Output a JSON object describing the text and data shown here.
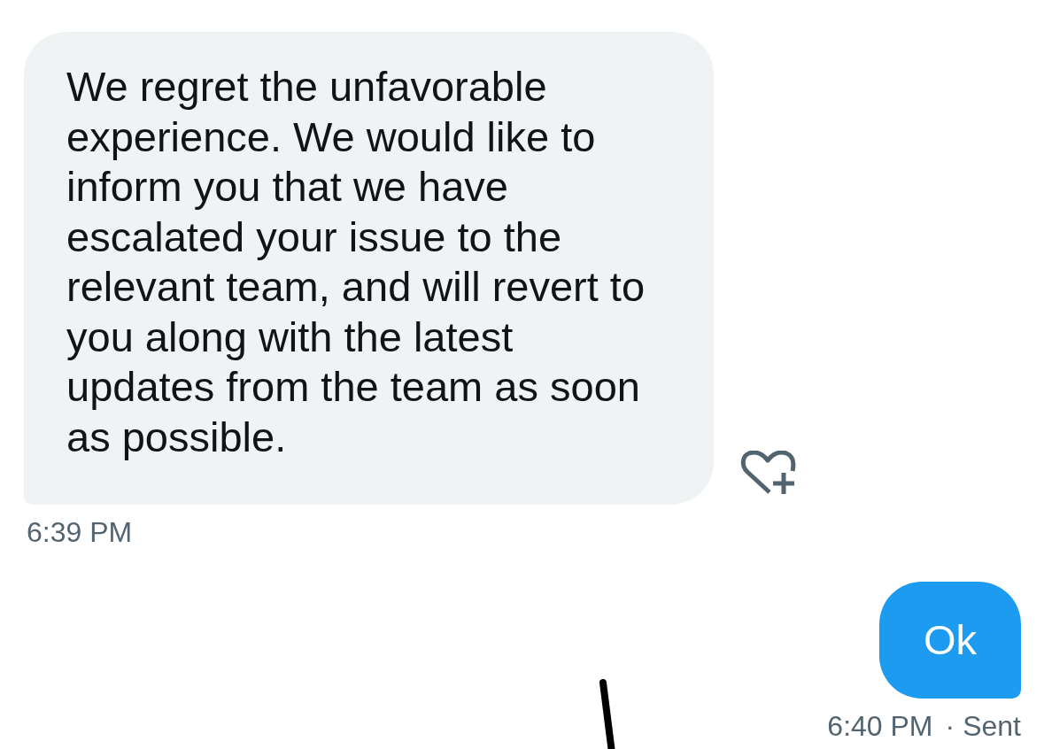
{
  "messages": [
    {
      "kind": "received",
      "text": "We regret the unfavorable experience. We would like to inform you that we have escalated your issue to the relevant team, and will revert to you along with the latest updates from the team as soon as possible.",
      "time": "6:39 PM"
    },
    {
      "kind": "sent",
      "text": "Ok",
      "time": "6:40 PM",
      "separator": "·",
      "status": "Sent"
    }
  ]
}
